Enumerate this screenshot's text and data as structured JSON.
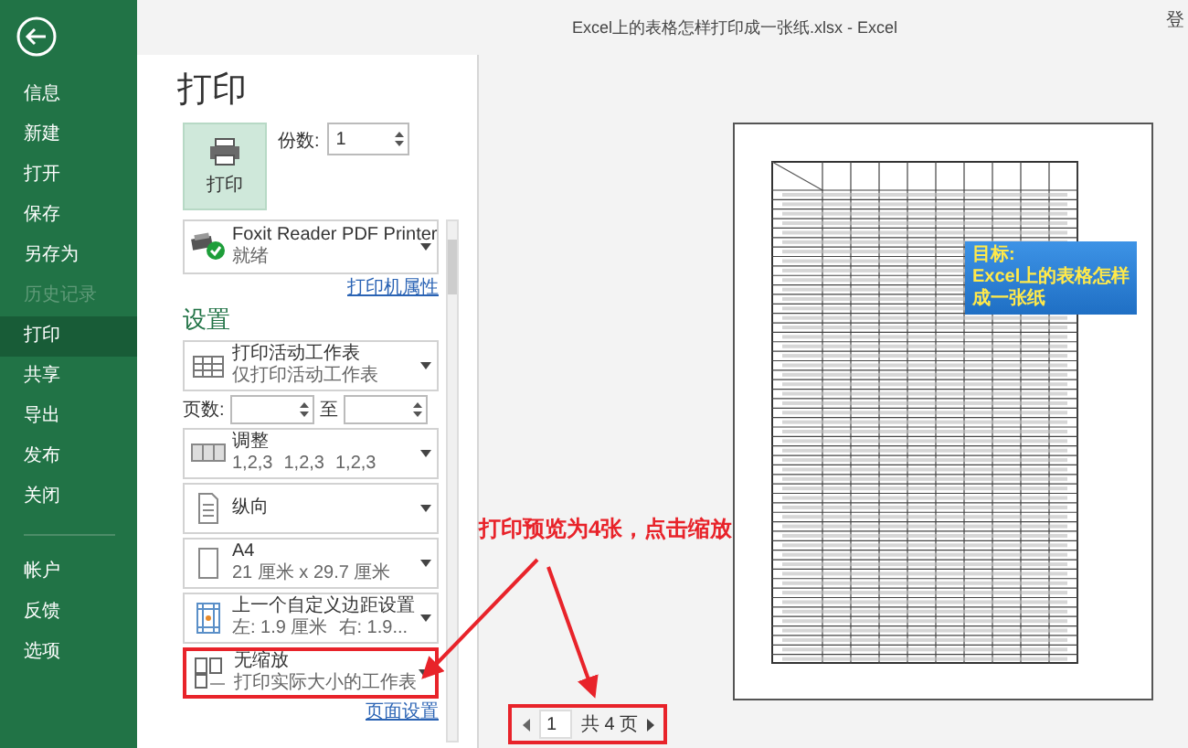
{
  "window": {
    "title": "Excel上的表格怎样打印成一张纸.xlsx  -  Excel",
    "account": "登"
  },
  "sidebar": {
    "items": [
      {
        "label": "信息",
        "selected": false,
        "disabled": false
      },
      {
        "label": "新建",
        "selected": false,
        "disabled": false
      },
      {
        "label": "打开",
        "selected": false,
        "disabled": false
      },
      {
        "label": "保存",
        "selected": false,
        "disabled": false
      },
      {
        "label": "另存为",
        "selected": false,
        "disabled": false
      },
      {
        "label": "历史记录",
        "selected": false,
        "disabled": true
      },
      {
        "label": "打印",
        "selected": true,
        "disabled": false
      },
      {
        "label": "共享",
        "selected": false,
        "disabled": false
      },
      {
        "label": "导出",
        "selected": false,
        "disabled": false
      },
      {
        "label": "发布",
        "selected": false,
        "disabled": false
      },
      {
        "label": "关闭",
        "selected": false,
        "disabled": false
      }
    ],
    "bottom_items": [
      {
        "label": "帐户",
        "selected": false,
        "disabled": false
      },
      {
        "label": "反馈",
        "selected": false,
        "disabled": false
      },
      {
        "label": "选项",
        "selected": false,
        "disabled": false
      }
    ]
  },
  "print": {
    "title": "打印",
    "print_button": "打印",
    "copies": {
      "label": "份数:",
      "value": "1"
    },
    "printer": {
      "name": "Foxit Reader PDF Printer",
      "status": "就绪",
      "properties_link": "打印机属性"
    },
    "settings_title": "设置",
    "settings": [
      {
        "kind": "dropdown",
        "title": "打印活动工作表",
        "subtitle": [
          "仅打印活动工作表"
        ],
        "annotated": false
      },
      {
        "kind": "pages",
        "label": "页数:",
        "to": "至"
      },
      {
        "kind": "dropdown",
        "title": "调整",
        "subtitle": [
          "1,2,3",
          "1,2,3",
          "1,2,3"
        ],
        "annotated": false
      },
      {
        "kind": "dropdown",
        "title": "纵向",
        "annotated": false
      },
      {
        "kind": "dropdown",
        "title": "A4",
        "subtitle": [
          "21 厘米 x 29.7 厘米"
        ],
        "annotated": false
      },
      {
        "kind": "dropdown",
        "title": "上一个自定义边距设置",
        "subtitle": [
          "左: 1.9 厘米",
          "右: 1.9..."
        ],
        "annotated": false
      },
      {
        "kind": "dropdown",
        "title": "无缩放",
        "subtitle": [
          "打印实际大小的工作表"
        ],
        "annotated": true
      }
    ],
    "page_setup_link": "页面设置"
  },
  "preview": {
    "callout": [
      "目标:",
      "Excel上的表格怎样",
      "成一张纸"
    ],
    "page_nav": {
      "current": "1",
      "total": "共 4 页",
      "annotated": true
    }
  },
  "annotation": {
    "text": "打印预览为4张，点击缩放"
  }
}
